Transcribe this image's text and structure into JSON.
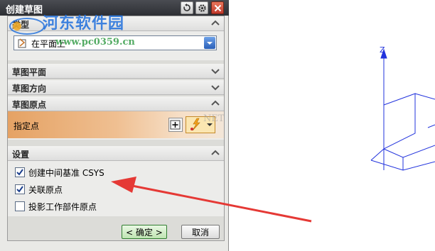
{
  "dialog": {
    "title": "创建草图"
  },
  "sections": {
    "type": {
      "title": "类型",
      "selected": "在平面上"
    },
    "sketch_plane": {
      "title": "草图平面"
    },
    "sketch_direction": {
      "title": "草图方向"
    },
    "sketch_origin": {
      "title": "草图原点",
      "specify_point_label": "指定点"
    },
    "settings": {
      "title": "设置",
      "options": [
        {
          "label": "创建中间基准 CSYS",
          "checked": true
        },
        {
          "label": "关联原点",
          "checked": true
        },
        {
          "label": "投影工作部件原点",
          "checked": false
        }
      ]
    }
  },
  "buttons": {
    "ok": "< 确定 >",
    "cancel": "取消"
  },
  "canvas": {
    "axis_label": "Z"
  },
  "watermark": {
    "site_name": "河东软件园",
    "site_url": "www.pc0359.cn",
    "overlay_text": "NET"
  },
  "colors": {
    "titlebar": "#3a3c42",
    "arrow": "#e53935",
    "axis": "#2233dd",
    "origin_band": "#e5a264"
  }
}
